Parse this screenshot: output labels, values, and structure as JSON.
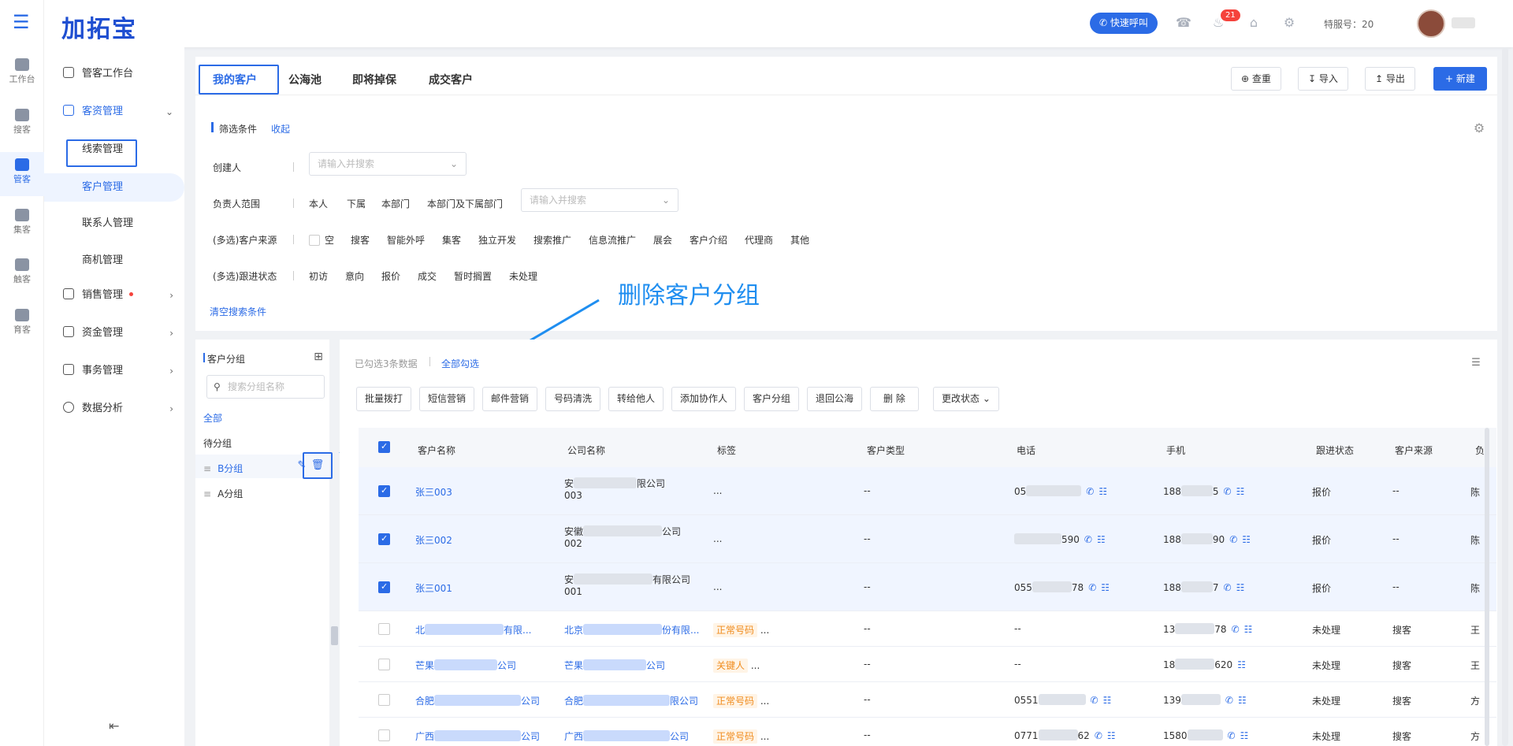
{
  "brand": {
    "logo": "加拓宝"
  },
  "header": {
    "quick_call": "快速呼叫",
    "notify_count": "21",
    "tefu_label": "特服号：20"
  },
  "rail": [
    {
      "label": "工作台"
    },
    {
      "label": "搜客"
    },
    {
      "label": "管客"
    },
    {
      "label": "集客"
    },
    {
      "label": "触客"
    },
    {
      "label": "育客"
    }
  ],
  "menu": {
    "workbench": "管客工作台",
    "customer_mgmt": "客资管理",
    "sub": [
      "线索管理",
      "客户管理",
      "联系人管理",
      "商机管理"
    ],
    "sales": "销售管理",
    "finance": "资金管理",
    "affairs": "事务管理",
    "analysis": "数据分析"
  },
  "tabs": [
    "我的客户",
    "公海池",
    "即将掉保",
    "成交客户"
  ],
  "toolbar": {
    "dup": "查重",
    "import": "导入",
    "export": "导出",
    "new": "+ 新建"
  },
  "filters": {
    "title": "筛选条件",
    "collapse": "收起",
    "creator": "创建人",
    "placeholder": "请输入并搜索",
    "owner_scope": "负责人范围",
    "owner_opts": [
      "本人",
      "下属",
      "本部门",
      "本部门及下属部门"
    ],
    "source": "(多选)客户来源",
    "source_opts": [
      "空",
      "搜客",
      "智能外呼",
      "集客",
      "独立开发",
      "搜索推广",
      "信息流推广",
      "展会",
      "客户介绍",
      "代理商",
      "其他"
    ],
    "follow": "(多选)跟进状态",
    "follow_opts": [
      "初访",
      "意向",
      "报价",
      "成交",
      "暂时搁置",
      "未处理"
    ],
    "clear": "清空搜索条件"
  },
  "annotation": "删除客户分组",
  "groups": {
    "title": "客户分组",
    "search_placeholder": "搜索分组名称",
    "items": [
      "全部",
      "待分组",
      "B分组",
      "A分组"
    ]
  },
  "selection": {
    "info": "已勾选3条数据",
    "select_all": "全部勾选"
  },
  "actions": [
    "批量拨打",
    "短信营销",
    "邮件营销",
    "号码清洗",
    "转给他人",
    "添加协作人",
    "客户分组",
    "退回公海",
    "删 除",
    "更改状态"
  ],
  "columns": [
    "客户名称",
    "公司名称",
    "标签",
    "客户类型",
    "电话",
    "手机",
    "跟进状态",
    "客户来源",
    "负"
  ],
  "rows": [
    {
      "name": "张三003",
      "company_a": "安",
      "company_b": "限公司",
      "company_line2": "003",
      "tag": "...",
      "type": "--",
      "tel_a": "05",
      "tel_b": "",
      "mob_a": "188",
      "mob_b": "5",
      "status": "报价",
      "source": "--",
      "owner": "陈"
    },
    {
      "name": "张三002",
      "company_a": "安徽",
      "company_b": "公司",
      "company_line2": "002",
      "tag": "...",
      "type": "--",
      "tel_a": "",
      "tel_b": "590",
      "mob_a": "188",
      "mob_b": "90",
      "status": "报价",
      "source": "--",
      "owner": "陈"
    },
    {
      "name": "张三001",
      "company_a": "安",
      "company_b": "有限公司",
      "company_line2": "001",
      "tag": "...",
      "type": "--",
      "tel_a": "055",
      "tel_b": "78",
      "mob_a": "188",
      "mob_b": "7",
      "status": "报价",
      "source": "--",
      "owner": "陈"
    },
    {
      "name_a": "北",
      "name_b": "有限...",
      "comp_a": "北京",
      "comp_b": "份有限...",
      "tag": "正常号码",
      "type": "--",
      "tel": "--",
      "mob_a": "13",
      "mob_b": "78",
      "status": "未处理",
      "source": "搜客",
      "owner": "王"
    },
    {
      "name_a": "芒果",
      "name_b": "公司",
      "comp_a": "芒果",
      "comp_b": "公司",
      "tag": "关键人",
      "type": "--",
      "tel": "--",
      "mob_a": "18",
      "mob_b": "620",
      "status": "未处理",
      "source": "搜客",
      "owner": "王"
    },
    {
      "name_a": "合肥",
      "name_b": "公司",
      "comp_a": "合肥",
      "comp_b": "限公司",
      "tag": "正常号码",
      "type": "--",
      "tel_a": "0551",
      "mob_a": "139",
      "status": "未处理",
      "source": "搜客",
      "owner": "方"
    },
    {
      "name_a": "广西",
      "name_b": "公司",
      "comp_a": "广西",
      "comp_b": "公司",
      "tag": "正常号码",
      "type": "--",
      "tel_a": "0771",
      "tel_b": "62",
      "mob_a": "1580",
      "status": "未处理",
      "source": "搜客",
      "owner": "方"
    }
  ]
}
